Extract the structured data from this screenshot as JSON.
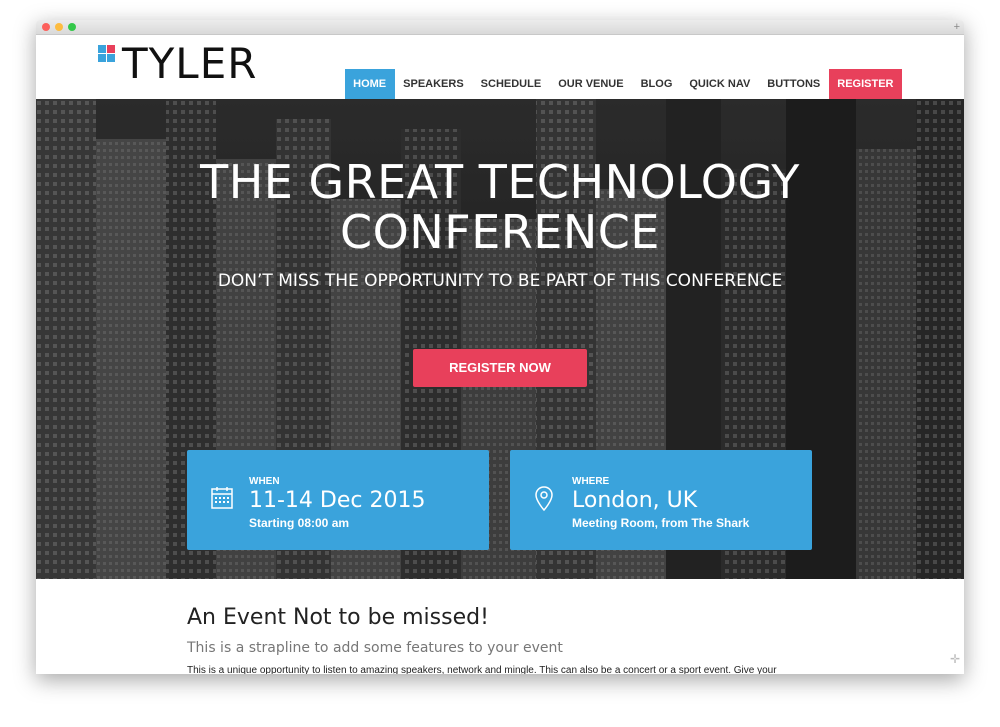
{
  "logo": {
    "text": "TYLER",
    "colors": [
      "#3aa3dc",
      "#e8405b",
      "#3aa3dc",
      "#3aa3dc"
    ]
  },
  "nav": {
    "items": [
      {
        "label": "HOME",
        "active": true
      },
      {
        "label": "SPEAKERS"
      },
      {
        "label": "SCHEDULE"
      },
      {
        "label": "OUR VENUE"
      },
      {
        "label": "BLOG"
      },
      {
        "label": "QUICK NAV"
      },
      {
        "label": "BUTTONS"
      },
      {
        "label": "REGISTER",
        "highlight": true
      }
    ]
  },
  "hero": {
    "title_line1": "THE GREAT TECHNOLOGY",
    "title_line2": "CONFERENCE",
    "subtitle": "DON’T MISS THE OPPORTUNITY TO BE PART OF THIS CONFERENCE",
    "cta_label": "REGISTER NOW"
  },
  "when": {
    "label": "WHEN",
    "value": "11-14 Dec 2015",
    "detail": "Starting 08:00 am",
    "icon": "calendar-icon"
  },
  "where": {
    "label": "WHERE",
    "value": "London, UK",
    "detail": "Meeting Room, from The Shark",
    "icon": "map-pin-icon"
  },
  "content": {
    "heading": "An Event Not to be missed!",
    "strapline": "This is a strapline to add some features to your event",
    "body": "This is a unique opportunity to listen to amazing speakers, network and mingle. This can also be a concert or a sport event. Give your"
  },
  "colors": {
    "accent_blue": "#3aa3dc",
    "accent_red": "#e8405b"
  }
}
